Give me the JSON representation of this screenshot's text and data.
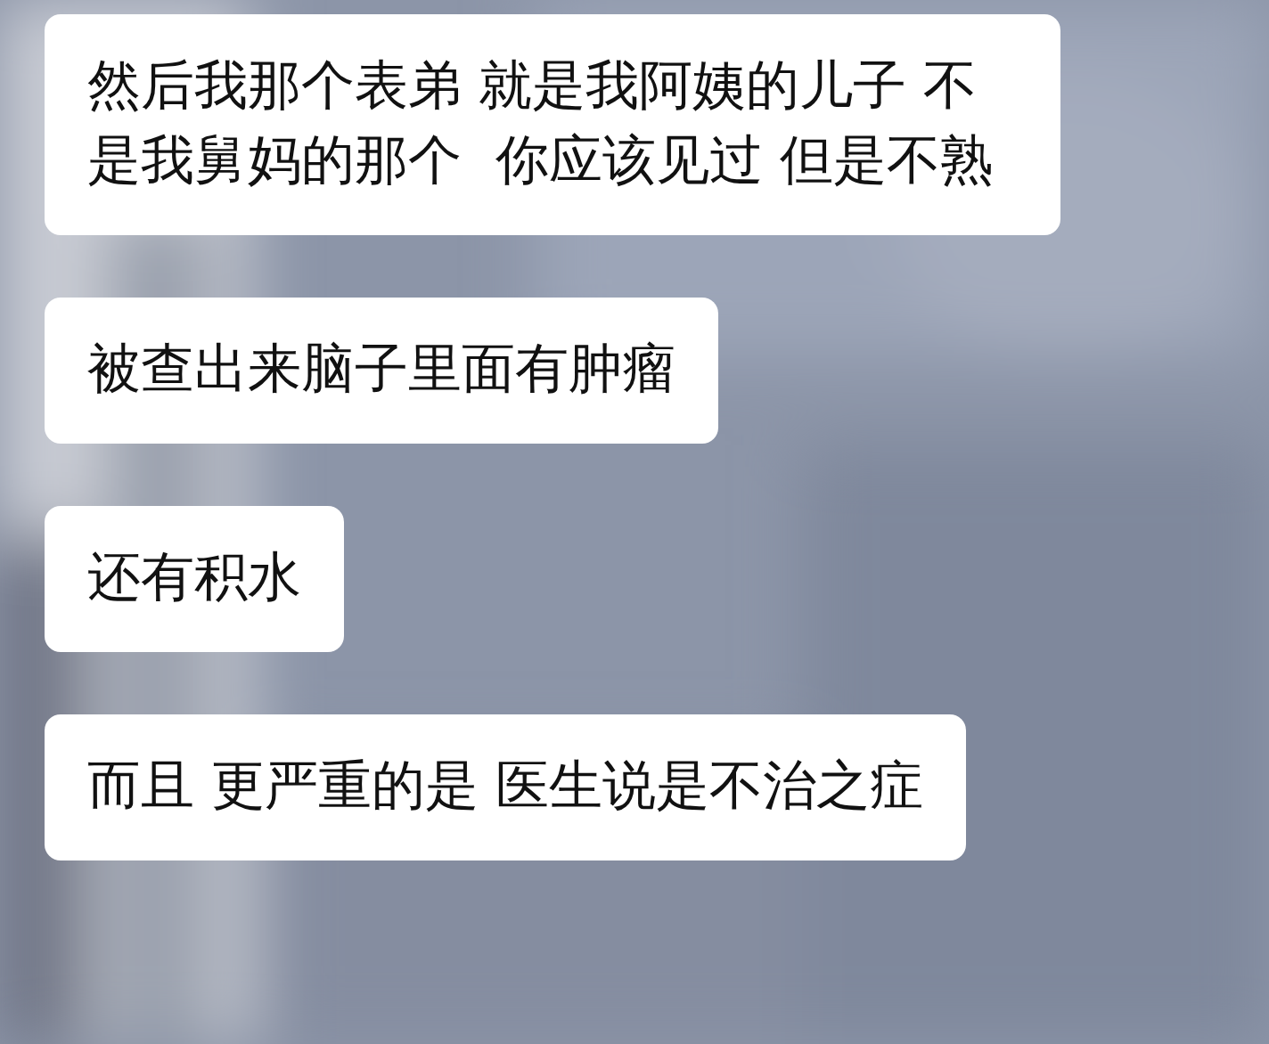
{
  "messages": [
    {
      "text": "然后我那个表弟 就是我阿姨的儿子 不是我舅妈的那个  你应该见过 但是不熟"
    },
    {
      "text": "被查出来脑子里面有肿瘤"
    },
    {
      "text": "还有积水"
    },
    {
      "text": "而且 更严重的是 医生说是不治之症"
    }
  ]
}
